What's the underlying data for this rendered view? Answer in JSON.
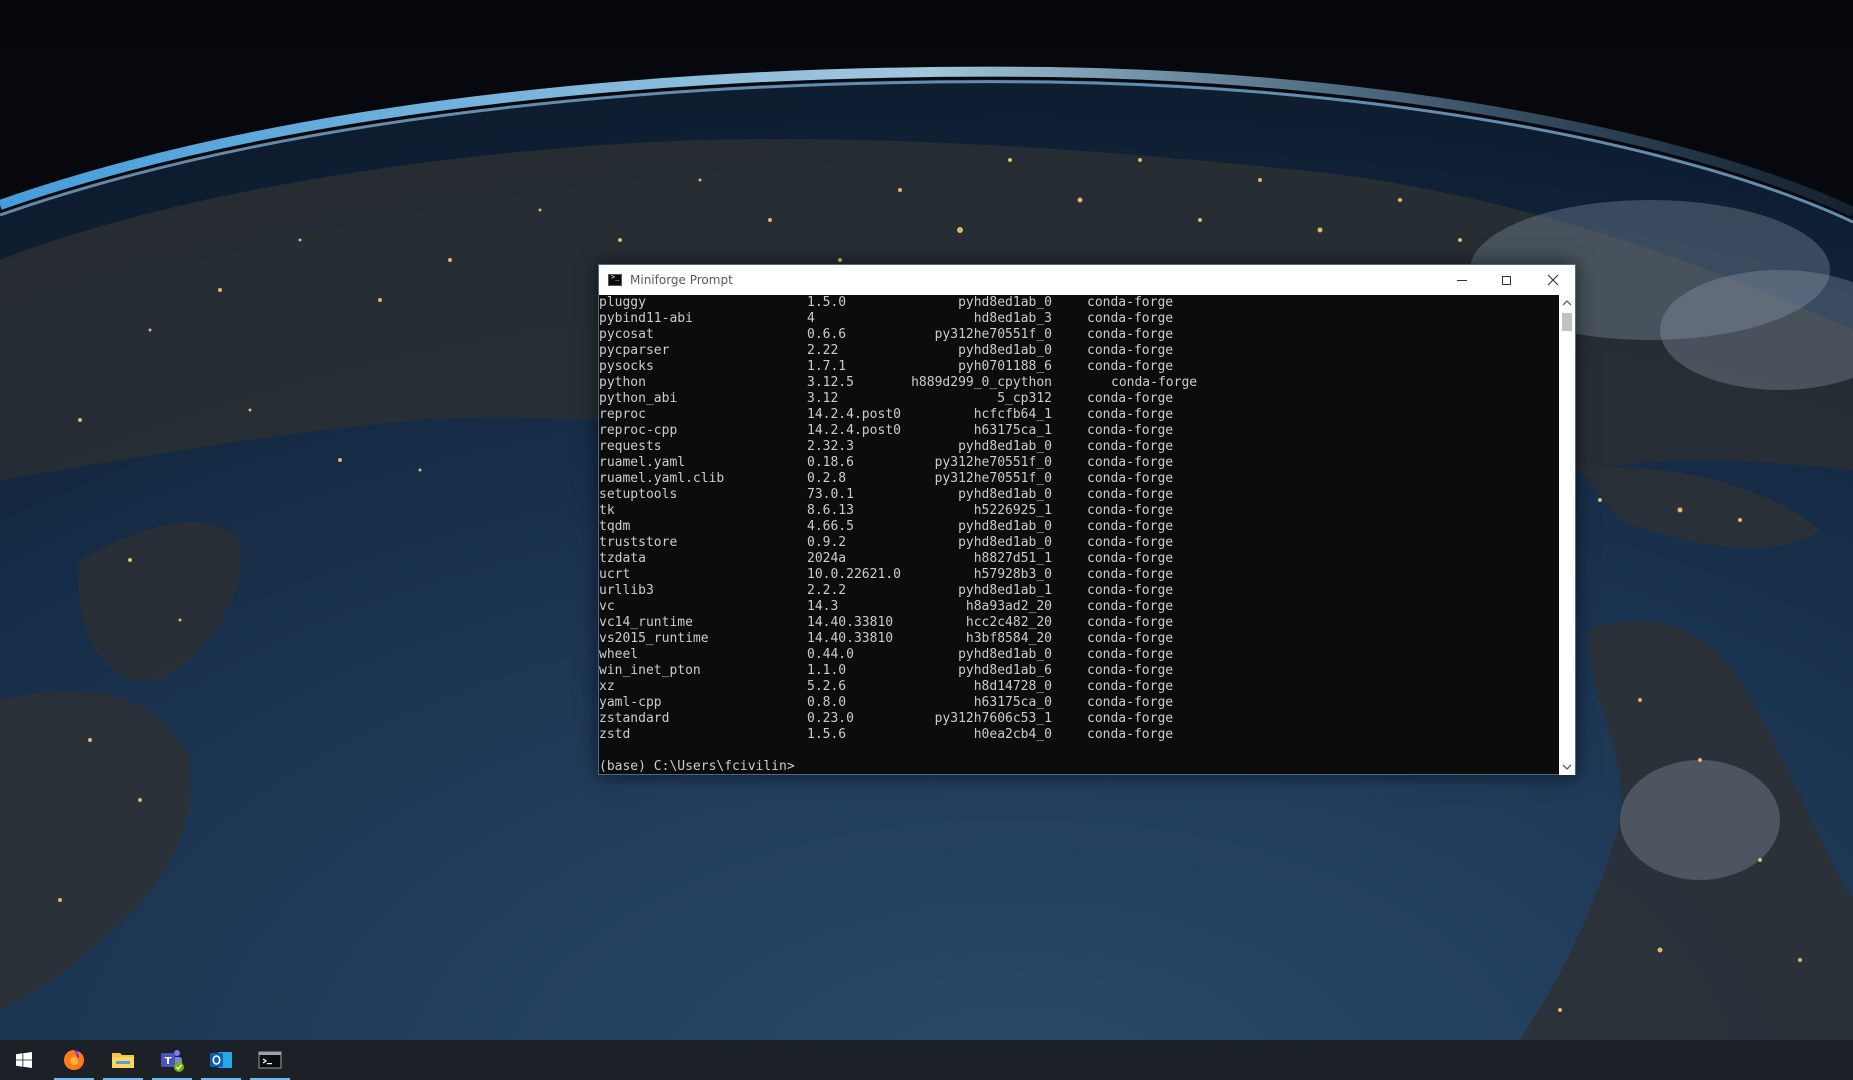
{
  "window": {
    "title": "Miniforge Prompt",
    "icon": "console-icon"
  },
  "console": {
    "packages": [
      {
        "name": "pluggy",
        "version": "1.5.0",
        "build": "pyhd8ed1ab_0",
        "channel": "conda-forge"
      },
      {
        "name": "pybind11-abi",
        "version": "4",
        "build": "hd8ed1ab_3",
        "channel": "conda-forge"
      },
      {
        "name": "pycosat",
        "version": "0.6.6",
        "build": "py312he70551f_0",
        "channel": "conda-forge"
      },
      {
        "name": "pycparser",
        "version": "2.22",
        "build": "pyhd8ed1ab_0",
        "channel": "conda-forge"
      },
      {
        "name": "pysocks",
        "version": "1.7.1",
        "build": "pyh0701188_6",
        "channel": "conda-forge"
      },
      {
        "name": "python",
        "version": "3.12.5",
        "build": "h889d299_0_cpython",
        "channel": "conda-forge"
      },
      {
        "name": "python_abi",
        "version": "3.12",
        "build": "5_cp312",
        "channel": "conda-forge"
      },
      {
        "name": "reproc",
        "version": "14.2.4.post0",
        "build": "hcfcfb64_1",
        "channel": "conda-forge"
      },
      {
        "name": "reproc-cpp",
        "version": "14.2.4.post0",
        "build": "h63175ca_1",
        "channel": "conda-forge"
      },
      {
        "name": "requests",
        "version": "2.32.3",
        "build": "pyhd8ed1ab_0",
        "channel": "conda-forge"
      },
      {
        "name": "ruamel.yaml",
        "version": "0.18.6",
        "build": "py312he70551f_0",
        "channel": "conda-forge"
      },
      {
        "name": "ruamel.yaml.clib",
        "version": "0.2.8",
        "build": "py312he70551f_0",
        "channel": "conda-forge"
      },
      {
        "name": "setuptools",
        "version": "73.0.1",
        "build": "pyhd8ed1ab_0",
        "channel": "conda-forge"
      },
      {
        "name": "tk",
        "version": "8.6.13",
        "build": "h5226925_1",
        "channel": "conda-forge"
      },
      {
        "name": "tqdm",
        "version": "4.66.5",
        "build": "pyhd8ed1ab_0",
        "channel": "conda-forge"
      },
      {
        "name": "truststore",
        "version": "0.9.2",
        "build": "pyhd8ed1ab_0",
        "channel": "conda-forge"
      },
      {
        "name": "tzdata",
        "version": "2024a",
        "build": "h8827d51_1",
        "channel": "conda-forge"
      },
      {
        "name": "ucrt",
        "version": "10.0.22621.0",
        "build": "h57928b3_0",
        "channel": "conda-forge"
      },
      {
        "name": "urllib3",
        "version": "2.2.2",
        "build": "pyhd8ed1ab_1",
        "channel": "conda-forge"
      },
      {
        "name": "vc",
        "version": "14.3",
        "build": "h8a93ad2_20",
        "channel": "conda-forge"
      },
      {
        "name": "vc14_runtime",
        "version": "14.40.33810",
        "build": "hcc2c482_20",
        "channel": "conda-forge"
      },
      {
        "name": "vs2015_runtime",
        "version": "14.40.33810",
        "build": "h3bf8584_20",
        "channel": "conda-forge"
      },
      {
        "name": "wheel",
        "version": "0.44.0",
        "build": "pyhd8ed1ab_0",
        "channel": "conda-forge"
      },
      {
        "name": "win_inet_pton",
        "version": "1.1.0",
        "build": "pyhd8ed1ab_6",
        "channel": "conda-forge"
      },
      {
        "name": "xz",
        "version": "5.2.6",
        "build": "h8d14728_0",
        "channel": "conda-forge"
      },
      {
        "name": "yaml-cpp",
        "version": "0.8.0",
        "build": "h63175ca_0",
        "channel": "conda-forge"
      },
      {
        "name": "zstandard",
        "version": "0.23.0",
        "build": "py312h7606c53_1",
        "channel": "conda-forge"
      },
      {
        "name": "zstd",
        "version": "1.5.6",
        "build": "h0ea2cb4_0",
        "channel": "conda-forge"
      }
    ],
    "prompt": "(base) C:\\Users\\fcivilin>"
  },
  "taskbar": {
    "items": [
      {
        "name": "start-button",
        "icon": "windows-logo-icon",
        "active": false
      },
      {
        "name": "taskbar-firefox",
        "icon": "firefox-icon",
        "active": true
      },
      {
        "name": "taskbar-file-explorer",
        "icon": "folder-icon",
        "active": true
      },
      {
        "name": "taskbar-teams",
        "icon": "teams-icon",
        "active": true
      },
      {
        "name": "taskbar-outlook",
        "icon": "outlook-icon",
        "active": true
      },
      {
        "name": "taskbar-terminal",
        "icon": "console-icon",
        "active": true
      }
    ]
  },
  "colors": {
    "console_bg": "#0c0c0c",
    "console_text": "#cccccc",
    "taskbar_bg": "#1c2128",
    "taskbar_accent": "#76b9ed"
  }
}
